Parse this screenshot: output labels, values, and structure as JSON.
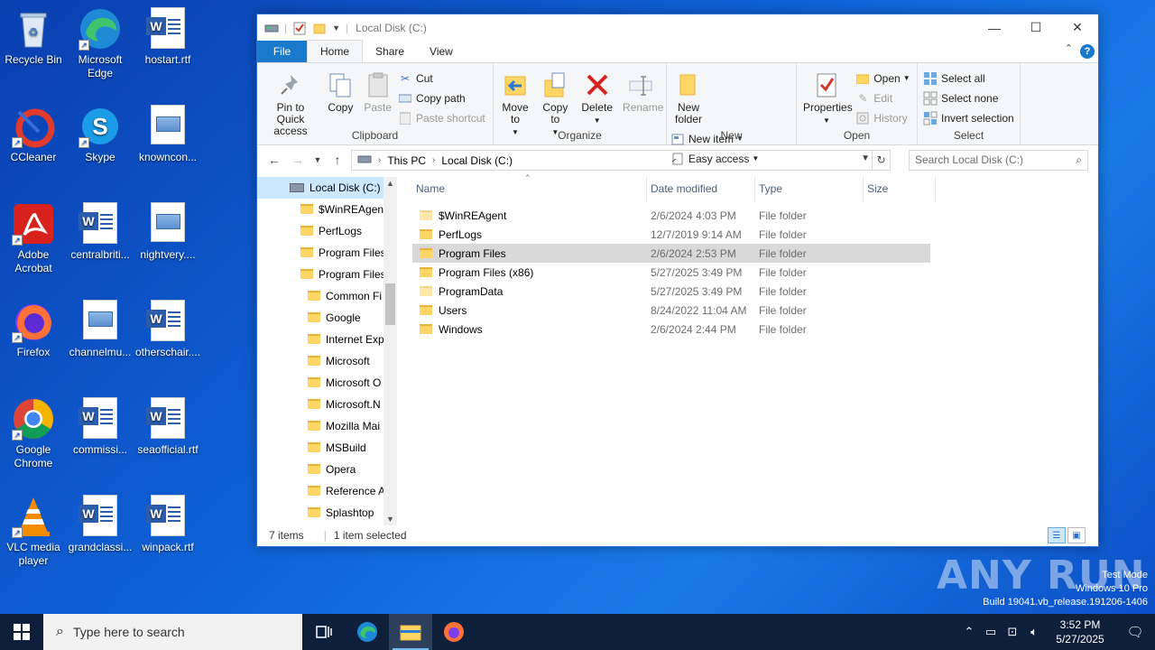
{
  "desktop": {
    "icons": [
      {
        "label": "Recycle Bin",
        "icon": "recycle-bin-icon"
      },
      {
        "label": "Microsoft Edge",
        "icon": "edge-icon"
      },
      {
        "label": "hostart.rtf",
        "icon": "word-doc-icon"
      },
      {
        "label": "CCleaner",
        "icon": "ccleaner-icon"
      },
      {
        "label": "Skype",
        "icon": "skype-icon"
      },
      {
        "label": "knowncon...",
        "icon": "image-file-icon"
      },
      {
        "label": "Adobe Acrobat",
        "icon": "acrobat-icon"
      },
      {
        "label": "centralbriti...",
        "icon": "word-doc-icon"
      },
      {
        "label": "nightvery....",
        "icon": "image-file-icon"
      },
      {
        "label": "Firefox",
        "icon": "firefox-icon"
      },
      {
        "label": "channelmu...",
        "icon": "image-file-icon"
      },
      {
        "label": "otherschair....",
        "icon": "word-doc-icon"
      },
      {
        "label": "Google Chrome",
        "icon": "chrome-icon"
      },
      {
        "label": "commissi...",
        "icon": "word-doc-icon"
      },
      {
        "label": "seaofficial.rtf",
        "icon": "word-doc-icon"
      },
      {
        "label": "VLC media player",
        "icon": "vlc-icon"
      },
      {
        "label": "grandclassi...",
        "icon": "word-doc-icon"
      },
      {
        "label": "winpack.rtf",
        "icon": "word-doc-icon"
      }
    ]
  },
  "window": {
    "title": "Local Disk (C:)",
    "tabs": {
      "file": "File",
      "home": "Home",
      "share": "Share",
      "view": "View"
    },
    "ribbon": {
      "clipboard": {
        "name": "Clipboard",
        "pin": "Pin to Quick access",
        "copy": "Copy",
        "paste": "Paste",
        "cut": "Cut",
        "copy_path": "Copy path",
        "paste_shortcut": "Paste shortcut"
      },
      "organize": {
        "name": "Organize",
        "move_to": "Move to",
        "copy_to": "Copy to",
        "delete": "Delete",
        "rename": "Rename"
      },
      "new": {
        "name": "New",
        "new_folder": "New folder",
        "new_item": "New item",
        "easy_access": "Easy access"
      },
      "open": {
        "name": "Open",
        "properties": "Properties",
        "open": "Open",
        "edit": "Edit",
        "history": "History"
      },
      "select": {
        "name": "Select",
        "select_all": "Select all",
        "select_none": "Select none",
        "invert": "Invert selection"
      }
    },
    "address": {
      "crumbs": [
        "This PC",
        "Local Disk (C:)"
      ],
      "search_placeholder": "Search Local Disk (C:)"
    },
    "nav_pane": [
      {
        "label": "Local Disk (C:)",
        "level": 0,
        "selected": true,
        "drive": true
      },
      {
        "label": "$WinREAgent",
        "level": 1
      },
      {
        "label": "PerfLogs",
        "level": 1
      },
      {
        "label": "Program Files",
        "level": 1
      },
      {
        "label": "Program Files",
        "level": 1
      },
      {
        "label": "Common Fi",
        "level": 2
      },
      {
        "label": "Google",
        "level": 2
      },
      {
        "label": "Internet Exp",
        "level": 2
      },
      {
        "label": "Microsoft",
        "level": 2
      },
      {
        "label": "Microsoft O",
        "level": 2
      },
      {
        "label": "Microsoft.N",
        "level": 2
      },
      {
        "label": "Mozilla Mai",
        "level": 2
      },
      {
        "label": "MSBuild",
        "level": 2
      },
      {
        "label": "Opera",
        "level": 2
      },
      {
        "label": "Reference A",
        "level": 2
      },
      {
        "label": "Splashtop",
        "level": 2
      }
    ],
    "columns": {
      "name": "Name",
      "date": "Date modified",
      "type": "Type",
      "size": "Size"
    },
    "files": [
      {
        "name": "$WinREAgent",
        "date": "2/6/2024 4:03 PM",
        "type": "File folder",
        "size": "",
        "selected": false,
        "hidden": true
      },
      {
        "name": "PerfLogs",
        "date": "12/7/2019 9:14 AM",
        "type": "File folder",
        "size": "",
        "selected": false
      },
      {
        "name": "Program Files",
        "date": "2/6/2024 2:53 PM",
        "type": "File folder",
        "size": "",
        "selected": true
      },
      {
        "name": "Program Files (x86)",
        "date": "5/27/2025 3:49 PM",
        "type": "File folder",
        "size": "",
        "selected": false
      },
      {
        "name": "ProgramData",
        "date": "5/27/2025 3:49 PM",
        "type": "File folder",
        "size": "",
        "selected": false,
        "hidden": true
      },
      {
        "name": "Users",
        "date": "8/24/2022 11:04 AM",
        "type": "File folder",
        "size": "",
        "selected": false
      },
      {
        "name": "Windows",
        "date": "2/6/2024 2:44 PM",
        "type": "File folder",
        "size": "",
        "selected": false
      }
    ],
    "status": {
      "count": "7 items",
      "selection": "1 item selected"
    }
  },
  "watermark": {
    "brand": "ANY RUN",
    "lines": [
      "Test Mode",
      "Windows 10 Pro",
      "Build 19041.vb_release.191206-1406"
    ]
  },
  "taskbar": {
    "search_placeholder": "Type here to search",
    "time": "3:52 PM",
    "date": "5/27/2025"
  },
  "colors": {
    "accent": "#1979ca",
    "selection": "#cce8ff",
    "taskbar": "#0d1f3a"
  }
}
